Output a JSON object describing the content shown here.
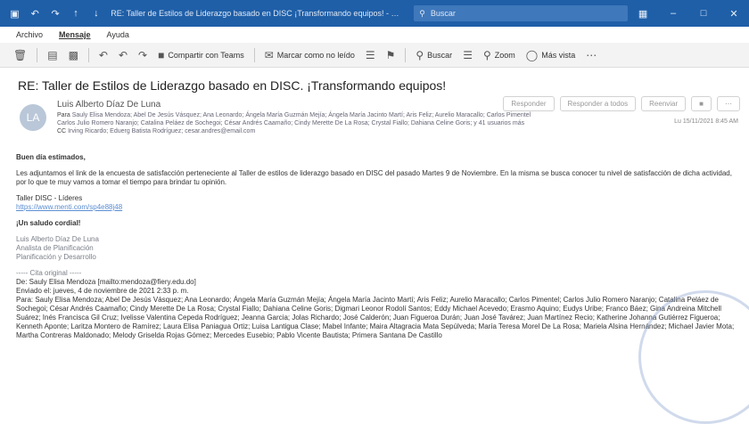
{
  "window": {
    "title": "RE: Taller de Estilos de Liderazgo basado en DISC ¡Transformando equipos! - Mensaje (HTML)",
    "search_placeholder": "Buscar"
  },
  "menu": [
    "Archivo",
    "Mensaje",
    "Ayuda"
  ],
  "ribbon": {
    "share_teams": "Compartir con Teams",
    "mark_unread": "Marcar como no leído",
    "search": "Buscar",
    "zoom": "Zoom",
    "read_aloud": "Más vista"
  },
  "message": {
    "subject": "RE: Taller de Estilos de Liderazgo basado en DISC. ¡Transformando equipos!",
    "avatar_initials": "LA",
    "sender": "Luis Alberto Díaz De Luna",
    "to_label": "Para",
    "recipients_line1": "Sauly Elisa Mendoza; Abel De Jesús Vásquez; Ana Leonardo; Ángela María Guzmán Mejía; Ángela María Jacinto Martí; Aris Feliz; Aurelio Maracallo; Carlos Pimentel",
    "recipients_line2": "Carlos Julio Romero Naranjo; Catalina Peláez de Sochegoi; César Andrés Caamaño; Cindy Merette De La Rosa; Crystal Fiallo; Dahiana Celine Goris; y 41 usuarios más",
    "cc_label": "CC",
    "recipients_line3": "Irving Ricardo; Eduerg Batista Rodríguez; cesar.andres@email.com",
    "reply": "Responder",
    "reply_all": "Responder a todos",
    "forward": "Reenviar",
    "timestamp": "Lu 15/11/2021 8:45 AM"
  },
  "body": {
    "greeting": "Buen día estimados,",
    "intro": "Les adjuntamos el link de la encuesta de satisfacción perteneciente al Taller de estilos de liderazgo basado en DISC del pasado Martes 9 de Noviembre. En la misma se busca conocer tu nivel de satisfacción de dicha actividad, por lo que te muy vamos a tomar el tiempo para brindar tu opinión.",
    "link_title": "Taller DISC - Líderes",
    "link_url": "https://www.menti.com/sp4e88j48",
    "closing": "¡Un saludo cordial!",
    "sig_name": "Luis Alberto Díaz De Luna",
    "sig_role": "Analista de Planificación",
    "sig_dept": "Planificación y Desarrollo",
    "orig_header": "----- Cita original -----",
    "orig_from": "De: Sauly Elisa Mendoza [mailto:mendoza@fiery.edu.do]",
    "orig_sent": "Enviado el: jueves, 4 de noviembre de 2021 2:33 p. m.",
    "orig_to": "Para: Sauly Elisa Mendoza; Abel De Jesús Vásquez; Ana Leonardo; Ángela María Guzmán Mejía; Ángela María Jacinto Martí; Aris Feliz; Aurelio Maracallo; Carlos Pimentel; Carlos Julio Romero Naranjo; Catalina Peláez de Sochegoi; César Andrés Caamaño; Cindy Merette De La Rosa; Crystal Fiallo; Dahiana Celine Goris; Digmari Leonor Rodolí Santos; Eddy Michael Acevedo; Erasmo Aquino; Eudys Uribe; Franco Báez; Gina Andreina Mitchell Suárez; Inés Francisca Gil Cruz; Ivelisse Valentina Cepeda Rodríguez; Jeanna Garcia; Jolas Richardo; José Calderón; Juan Figueroa Durán; Juan José Tavárez; Juan Martínez Recio; Katherine Johanna Gutiérrez Figueroa; Kenneth Aponte; Laritza Montero de Ramírez; Laura Elisa Paniagua Ortiz; Luisa Lantigua Clase; Mabel Infante; Maira Altagracia Mata Sepúlveda; María Teresa Morel De La Rosa; Mariela Alsina Hernández; Michael Javier Mota; Martha Contreras Maldonado; Melody Griselda Rojas Gómez; Mercedes Eusebio; Pablo Vicente Bautista; Primera Santana De Castillo"
  }
}
